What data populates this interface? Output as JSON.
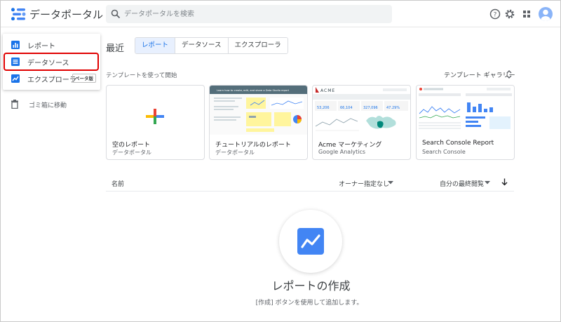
{
  "header": {
    "app_title": "データポータル",
    "search_placeholder": "データポータルを検索"
  },
  "sidebar": {
    "items": [
      {
        "label": "レポート",
        "icon": "report-icon"
      },
      {
        "label": "データソース",
        "icon": "data-source-icon"
      },
      {
        "label": "エクスプローラ",
        "icon": "explorer-icon",
        "badge": "ベータ版"
      }
    ],
    "trash_label": "ゴミ箱に移動"
  },
  "recent": {
    "title": "最近",
    "tabs": [
      {
        "label": "レポート",
        "active": true
      },
      {
        "label": "データソース",
        "active": false
      },
      {
        "label": "エクスプローラ",
        "active": false
      }
    ]
  },
  "templates": {
    "label": "テンプレートを使って開始",
    "gallery_label": "テンプレート ギャラリー",
    "cards": [
      {
        "title": "空のレポート",
        "subtitle": "データポータル"
      },
      {
        "title": "チュートリアルのレポート",
        "subtitle": "データポータル",
        "thumb_caption": "Learn how to create, edit, and share a Data Studio report"
      },
      {
        "title": "Acme マーケティング",
        "subtitle": "Google Analytics",
        "thumb_brand": "ACME",
        "metrics": [
          "53,206",
          "66,104",
          "327,096",
          "47.29%"
        ]
      },
      {
        "title": "Search Console Report",
        "subtitle": "Search Console"
      }
    ]
  },
  "list": {
    "name_header": "名前",
    "owner_filter": "オーナー指定なし",
    "sort_label": "自分の最終閲覧"
  },
  "empty_state": {
    "title": "レポートの作成",
    "subtitle": "[作成] ボタンを使用して追加します。"
  },
  "colors": {
    "accent": "#1a73e8",
    "active_tab_bg": "#e8f0fe",
    "highlight": "#e00000",
    "google_blue": "#4285f4",
    "google_red": "#ea4335",
    "google_yellow": "#fbbc04",
    "google_green": "#34a853"
  }
}
